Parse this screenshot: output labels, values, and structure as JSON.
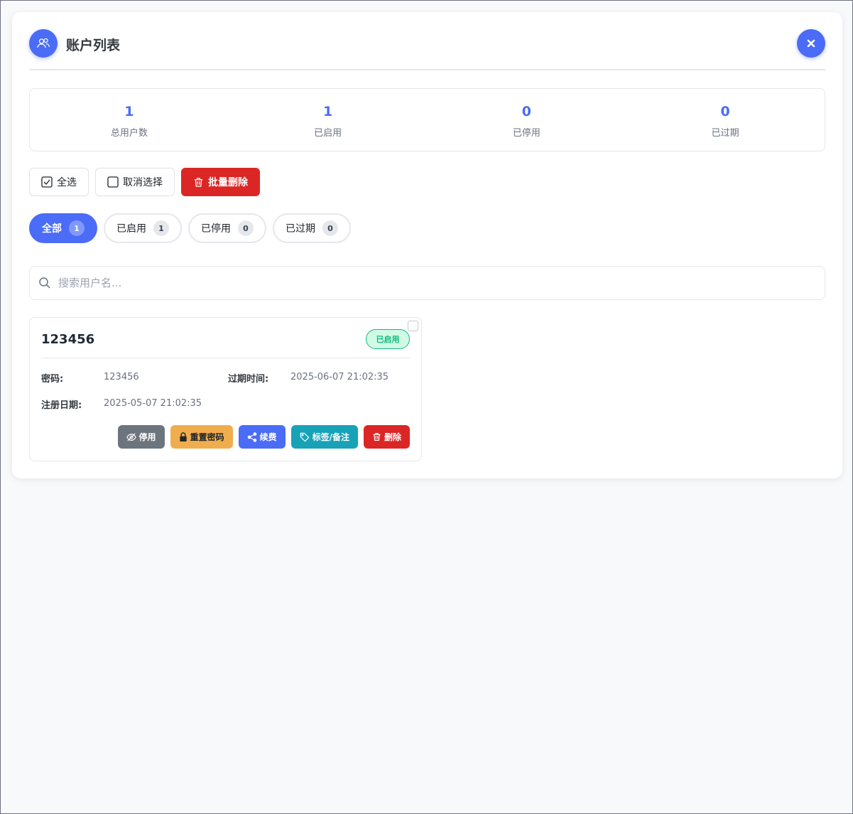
{
  "header": {
    "title": "账户列表",
    "icon": "users-icon"
  },
  "stats": [
    {
      "value": "1",
      "label": "总用户数"
    },
    {
      "value": "1",
      "label": "已启用"
    },
    {
      "value": "0",
      "label": "已停用"
    },
    {
      "value": "0",
      "label": "已过期"
    }
  ],
  "toolbar": {
    "select_all": "全选",
    "deselect": "取消选择",
    "batch_delete": "批量删除"
  },
  "filters": [
    {
      "label": "全部",
      "count": "1",
      "active": true
    },
    {
      "label": "已启用",
      "count": "1",
      "active": false
    },
    {
      "label": "已停用",
      "count": "0",
      "active": false
    },
    {
      "label": "已过期",
      "count": "0",
      "active": false
    }
  ],
  "search": {
    "placeholder": "搜索用户名...",
    "value": ""
  },
  "accounts": [
    {
      "username": "123456",
      "status": "已启用",
      "password_label": "密码:",
      "password": "123456",
      "expire_label": "过期时间:",
      "expire": "2025-06-07 21:02:35",
      "register_label": "注册日期:",
      "register": "2025-05-07 21:02:35",
      "actions": {
        "disable": "停用",
        "reset_password": "重置密码",
        "renew": "续费",
        "tags": "标签/备注",
        "delete": "删除"
      }
    }
  ],
  "colors": {
    "primary": "#4a6cf7",
    "danger": "#dc2626",
    "success": "#10b981",
    "warning": "#f0ad4e",
    "info": "#17a2b8",
    "secondary": "#6c757d"
  }
}
